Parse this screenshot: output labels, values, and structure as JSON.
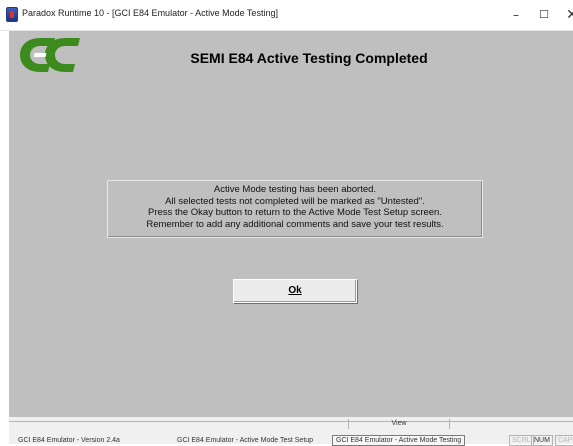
{
  "window": {
    "title": "Paradox Runtime 10 - [GCI E84 Emulator - Active Mode Testing]",
    "minimize_glyph": "–",
    "maximize_glyph": "☐",
    "close_glyph": "✕"
  },
  "logo": {
    "icon": "gci-logo",
    "colors": [
      "#3d8a1f",
      "#ffffff"
    ]
  },
  "form": {
    "heading": "SEMI E84 Active Testing Completed",
    "message_lines": [
      "Active Mode testing has been aborted.",
      "All selected tests not completed will be marked as \"Untested\".",
      "Press the Okay button to return to the Active Mode Test Setup screen.",
      "Remember to add any additional comments and save your test results."
    ],
    "ok_label": "Ok"
  },
  "statusbar": {
    "view_label": "View",
    "items": [
      "GCI E84 Emulator - Version 2.4a",
      "GCI E84 Emulator - Active Mode Test Setup",
      "GCI E84 Emulator - Active Mode Testing"
    ],
    "keys": {
      "scrl": "SCRL",
      "num": "NUM",
      "cap": "CAP"
    }
  },
  "colors": {
    "canvas_bg": "#bfbfbf",
    "logo_green": "#3d8a1f",
    "statusbar_bg": "#f0f0f0"
  }
}
